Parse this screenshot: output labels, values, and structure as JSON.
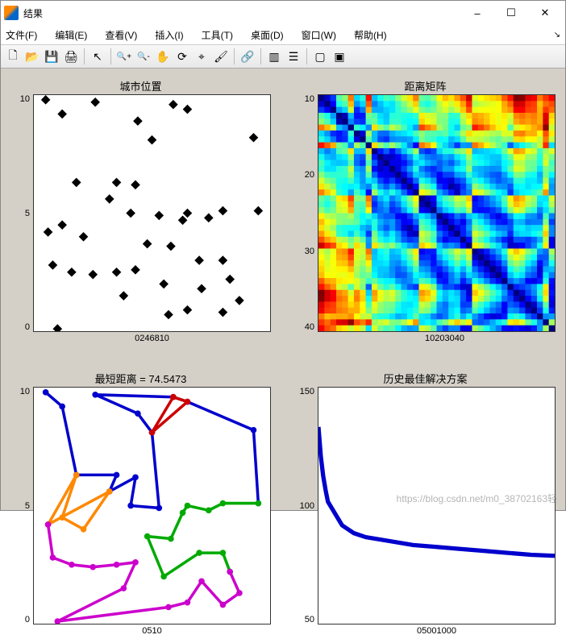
{
  "window": {
    "title": "结果",
    "minimize": "–",
    "maximize": "☐",
    "close": "✕"
  },
  "menus": {
    "file": "文件(F)",
    "edit": "编辑(E)",
    "view": "查看(V)",
    "insert": "插入(I)",
    "tools": "工具(T)",
    "desktop": "桌面(D)",
    "window": "窗口(W)",
    "help": "帮助(H)"
  },
  "toolbar_icons": {
    "new": "🗋",
    "open": "📂",
    "save": "💾",
    "print": "🖨",
    "pointer": "↖",
    "zoomin": "🔍+",
    "zoomout": "🔍-",
    "pan": "✋",
    "rotate": "⟳",
    "datacursor": "⌖",
    "brush": "🖌",
    "link": "🔗",
    "colorbar": "▥",
    "legend": "☰",
    "dock1": "▢",
    "dock2": "▣"
  },
  "watermark": "https://blog.csdn.net/m0_38702163轻",
  "chart_data": [
    {
      "type": "scatter",
      "title": "城市位置",
      "xlabel": "",
      "ylabel": "",
      "xlim": [
        0,
        10
      ],
      "ylim": [
        0,
        10
      ],
      "xticks": [
        0,
        2,
        4,
        6,
        8,
        10
      ],
      "yticks": [
        0,
        5,
        10
      ],
      "points": [
        [
          0.5,
          9.8
        ],
        [
          1.2,
          9.2
        ],
        [
          2.6,
          9.7
        ],
        [
          5.9,
          9.6
        ],
        [
          6.5,
          9.4
        ],
        [
          9.3,
          8.2
        ],
        [
          4.4,
          8.9
        ],
        [
          5.0,
          8.1
        ],
        [
          9.5,
          5.1
        ],
        [
          1.8,
          6.3
        ],
        [
          3.5,
          6.3
        ],
        [
          4.3,
          6.2
        ],
        [
          3.2,
          5.6
        ],
        [
          4.1,
          5.0
        ],
        [
          5.3,
          4.9
        ],
        [
          6.5,
          5.0
        ],
        [
          8.0,
          5.1
        ],
        [
          0.6,
          4.2
        ],
        [
          1.2,
          4.5
        ],
        [
          2.1,
          4.0
        ],
        [
          4.8,
          3.7
        ],
        [
          5.8,
          3.6
        ],
        [
          6.3,
          4.7
        ],
        [
          7.4,
          4.8
        ],
        [
          7.0,
          3.0
        ],
        [
          8.3,
          2.2
        ],
        [
          0.8,
          2.8
        ],
        [
          1.6,
          2.5
        ],
        [
          2.5,
          2.4
        ],
        [
          3.5,
          2.5
        ],
        [
          4.3,
          2.6
        ],
        [
          5.5,
          2.0
        ],
        [
          8.0,
          3.0
        ],
        [
          8.7,
          1.3
        ],
        [
          8.0,
          0.8
        ],
        [
          6.5,
          0.9
        ],
        [
          5.7,
          0.7
        ],
        [
          3.8,
          1.5
        ],
        [
          1.0,
          0.1
        ],
        [
          7.1,
          1.8
        ]
      ]
    },
    {
      "type": "heatmap",
      "title": "距离矩阵",
      "xlim": [
        1,
        40
      ],
      "ylim": [
        1,
        40
      ],
      "xticks": [
        10,
        20,
        30,
        40
      ],
      "yticks": [
        10,
        20,
        30,
        40
      ],
      "note": "40×40 symmetric distance matrix, jet colormap, diagonal = 0 (dark blue)"
    },
    {
      "type": "line",
      "title": "最短距离 = 74.5473",
      "xlim": [
        0,
        10
      ],
      "ylim": [
        0,
        10
      ],
      "xticks": [
        0,
        5,
        10
      ],
      "yticks": [
        0,
        5,
        10
      ],
      "series": [
        {
          "name": "path-blue",
          "color": "#0000cc",
          "points": [
            [
              0.5,
              9.8
            ],
            [
              1.2,
              9.2
            ],
            [
              1.8,
              6.3
            ],
            [
              3.5,
              6.3
            ],
            [
              3.2,
              5.6
            ],
            [
              4.3,
              6.2
            ],
            [
              4.1,
              5.0
            ],
            [
              5.3,
              4.9
            ],
            [
              5.0,
              8.1
            ],
            [
              4.4,
              8.9
            ],
            [
              2.6,
              9.7
            ],
            [
              5.9,
              9.6
            ],
            [
              6.5,
              9.4
            ],
            [
              9.3,
              8.2
            ],
            [
              9.5,
              5.1
            ]
          ]
        },
        {
          "name": "path-red",
          "color": "#cc0000",
          "points": [
            [
              5.9,
              9.6
            ],
            [
              5.0,
              8.1
            ],
            [
              6.5,
              9.4
            ],
            [
              5.9,
              9.6
            ]
          ]
        },
        {
          "name": "path-orange",
          "color": "#ff8800",
          "points": [
            [
              0.6,
              4.2
            ],
            [
              1.8,
              6.3
            ],
            [
              1.2,
              4.5
            ],
            [
              2.1,
              4.0
            ],
            [
              3.2,
              5.6
            ],
            [
              0.6,
              4.2
            ]
          ]
        },
        {
          "name": "path-green",
          "color": "#00aa00",
          "points": [
            [
              9.5,
              5.1
            ],
            [
              8.0,
              5.1
            ],
            [
              7.4,
              4.8
            ],
            [
              6.5,
              5.0
            ],
            [
              6.3,
              4.7
            ],
            [
              5.8,
              3.6
            ],
            [
              4.8,
              3.7
            ],
            [
              5.5,
              2.0
            ],
            [
              7.0,
              3.0
            ],
            [
              8.0,
              3.0
            ],
            [
              8.3,
              2.2
            ]
          ]
        },
        {
          "name": "path-magenta",
          "color": "#cc00cc",
          "points": [
            [
              0.6,
              4.2
            ],
            [
              0.8,
              2.8
            ],
            [
              1.6,
              2.5
            ],
            [
              2.5,
              2.4
            ],
            [
              3.5,
              2.5
            ],
            [
              4.3,
              2.6
            ],
            [
              3.8,
              1.5
            ],
            [
              1.0,
              0.1
            ],
            [
              5.7,
              0.7
            ],
            [
              6.5,
              0.9
            ],
            [
              7.1,
              1.8
            ],
            [
              8.0,
              0.8
            ],
            [
              8.7,
              1.3
            ],
            [
              8.3,
              2.2
            ]
          ]
        }
      ]
    },
    {
      "type": "line",
      "title": "历史最佳解决方案",
      "xlim": [
        0,
        1000
      ],
      "ylim": [
        40,
        160
      ],
      "xticks": [
        0,
        500,
        1000
      ],
      "yticks": [
        50,
        100,
        150
      ],
      "series": [
        {
          "name": "best",
          "color": "#0000cc",
          "x": [
            0,
            10,
            20,
            30,
            40,
            60,
            80,
            100,
            150,
            200,
            300,
            400,
            500,
            600,
            700,
            800,
            900,
            1000
          ],
          "y": [
            140,
            125,
            115,
            108,
            102,
            98,
            94,
            90,
            86,
            84,
            82,
            80,
            79,
            78,
            77,
            76,
            75,
            74.5
          ]
        }
      ]
    }
  ]
}
